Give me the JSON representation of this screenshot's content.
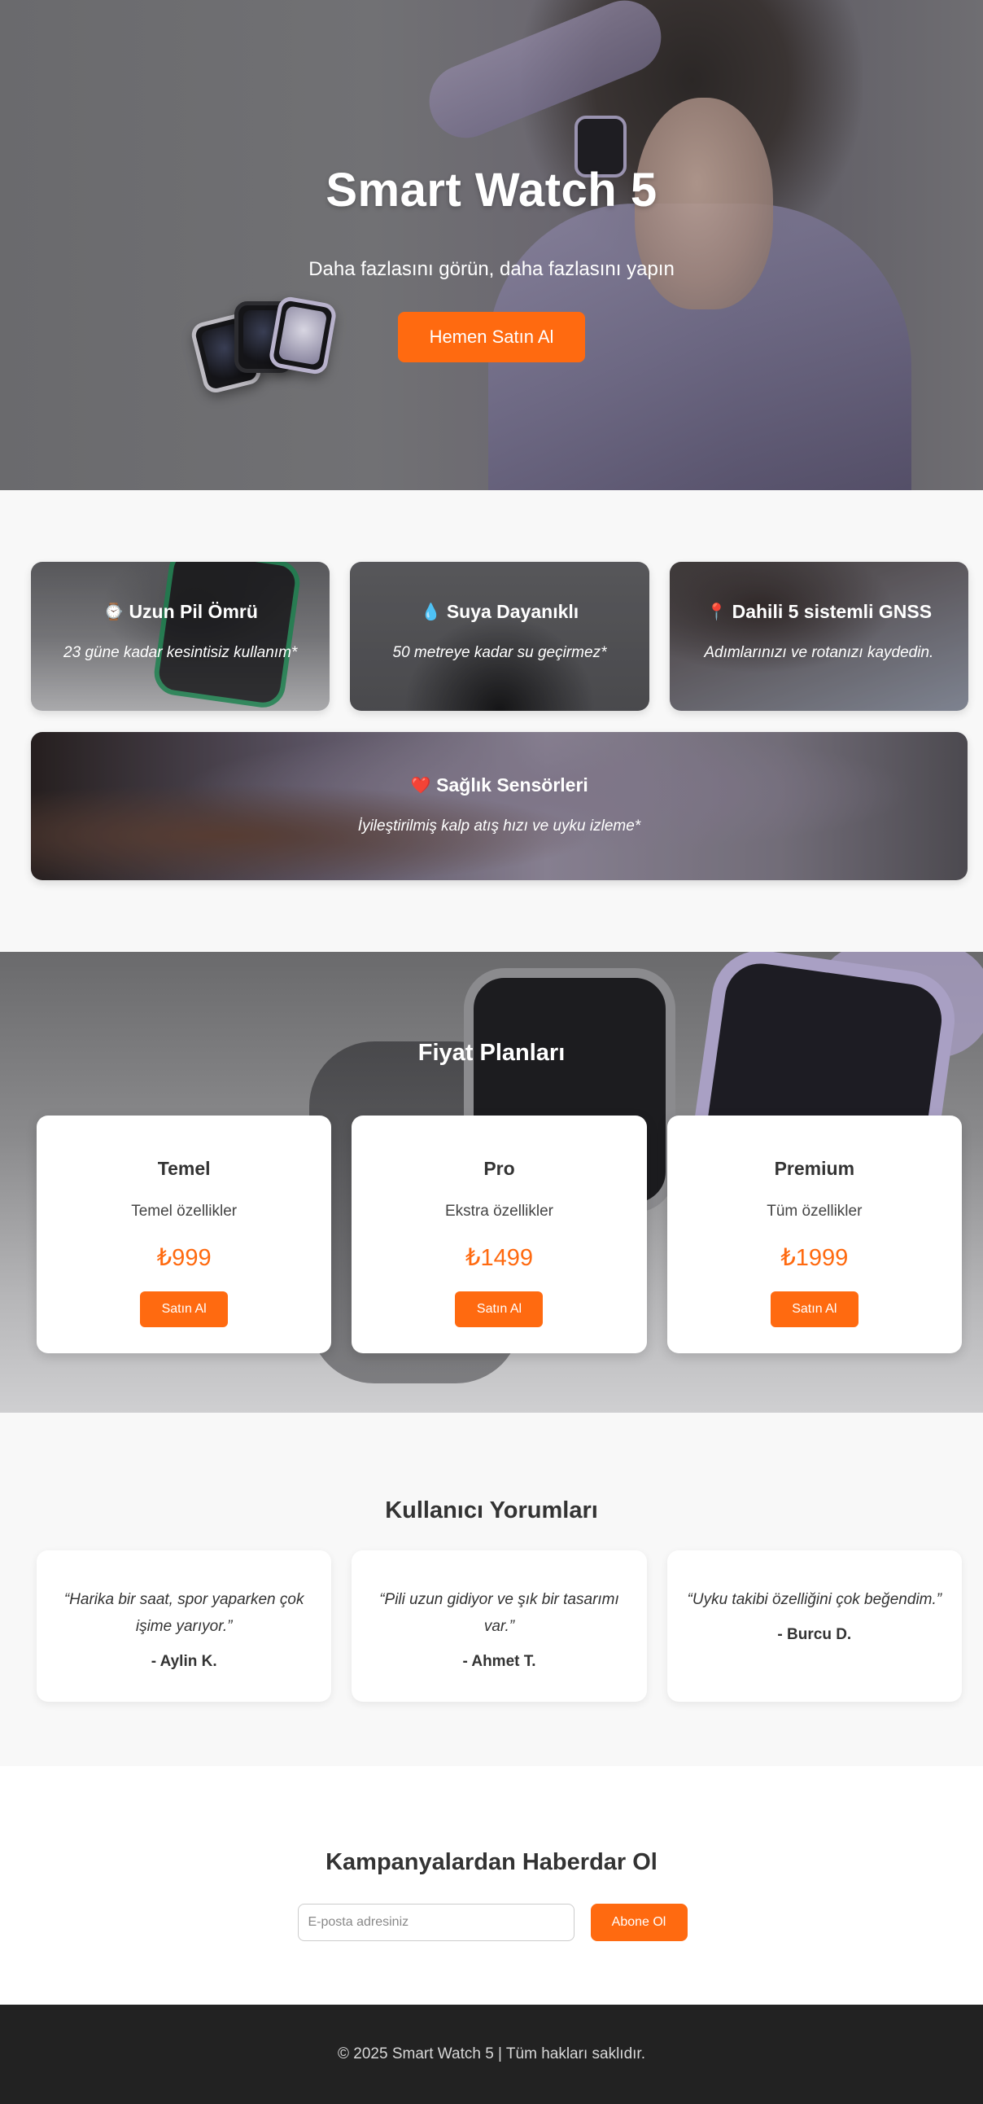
{
  "hero": {
    "title": "Smart Watch 5",
    "subtitle": "Daha fazlasını görün, daha fazlasını yapın",
    "cta_label": "Hemen Satın Al"
  },
  "features": {
    "items": [
      {
        "icon": "⌚",
        "icon_name": "watch-icon",
        "title": "Uzun Pil Ömrü",
        "description": "23 güne kadar kesintisiz kullanım*"
      },
      {
        "icon": "💧",
        "icon_name": "water-drop-icon",
        "title": "Suya Dayanıklı",
        "description": "50 metreye kadar su geçirmez*"
      },
      {
        "icon": "📍",
        "icon_name": "location-pin-icon",
        "title": "Dahili 5 sistemli GNSS",
        "description": "Adımlarınızı ve rotanızı kaydedin."
      },
      {
        "icon": "❤️",
        "icon_name": "heart-icon",
        "title": "Sağlık Sensörleri",
        "description": "İyileştirilmiş kalp atış hızı ve uyku izleme*"
      }
    ]
  },
  "pricing": {
    "title": "Fiyat Planları",
    "plans": [
      {
        "name": "Temel",
        "description": "Temel özellikler",
        "price": "₺999",
        "button_label": "Satın Al"
      },
      {
        "name": "Pro",
        "description": "Ekstra özellikler",
        "price": "₺1499",
        "button_label": "Satın Al"
      },
      {
        "name": "Premium",
        "description": "Tüm özellikler",
        "price": "₺1999",
        "button_label": "Satın Al"
      }
    ]
  },
  "testimonials": {
    "title": "Kullanıcı Yorumları",
    "items": [
      {
        "quote": "“Harika bir saat, spor yaparken çok işime yarıyor.”",
        "author": "- Aylin K."
      },
      {
        "quote": "“Pili uzun gidiyor ve şık bir tasarımı var.”",
        "author": "- Ahmet T."
      },
      {
        "quote": "“Uyku takibi özelliğini çok beğendim.”",
        "author": "- Burcu D."
      }
    ]
  },
  "newsletter": {
    "title": "Kampanyalardan Haberdar Ol",
    "email_placeholder": "E-posta adresiniz",
    "email_value": "",
    "button_label": "Abone Ol"
  },
  "footer": {
    "text": "© 2025 Smart Watch 5 | Tüm hakları saklıdır."
  },
  "colors": {
    "accent": "#ff6a10",
    "footer_bg": "#222222",
    "section_bg": "#f8f8f8"
  }
}
